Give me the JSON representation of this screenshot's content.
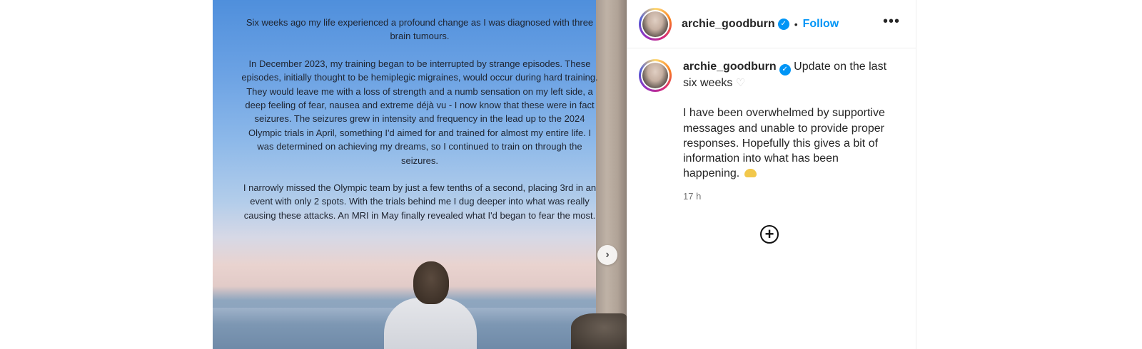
{
  "story": {
    "paragraphs": [
      "Six weeks ago my life experienced a profound change as I was diagnosed with three brain tumours.",
      "In December 2023, my training began to be interrupted by strange episodes. These episodes, initially thought to be hemiplegic migraines, would occur during hard training. They would leave me with a loss of strength and a numb sensation on my left side, a deep feeling of fear, nausea and extreme déjà vu - I now know that these were in fact seizures. The seizures grew in intensity and frequency in the lead up to the 2024 Olympic trials in April, something I'd aimed for and trained for almost my entire life. I was determined on achieving my dreams, so I continued to train on through the seizures.",
      "I narrowly missed the Olympic team by just a few tenths of a second, placing 3rd in an event with only 2 spots. With the trials behind me I dug deeper into what was really causing these attacks. An MRI in May finally revealed what I'd began to fear the most."
    ]
  },
  "header": {
    "username": "archie_goodburn",
    "separator": "•",
    "follow_label": "Follow",
    "more_label": "•••"
  },
  "caption": {
    "username": "archie_goodburn",
    "intro": "Update on the last six weeks",
    "body": "I have been overwhelmed by supportive messages and unable to provide proper responses. Hopefully this gives a bit of information into what has been happening.",
    "timestamp": "17 h"
  },
  "icons": {
    "verified": "verified-badge-icon",
    "heart": "white-heart-emoji",
    "hands": "heart-hands-emoji",
    "next": "chevron-right-icon",
    "add": "add-circle-icon"
  },
  "colors": {
    "accent": "#0095f6",
    "text": "#262626",
    "muted": "#737373"
  }
}
